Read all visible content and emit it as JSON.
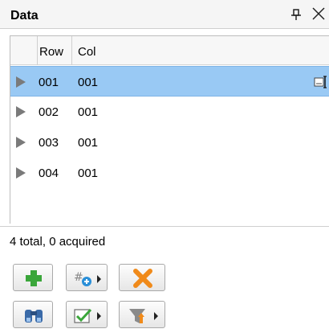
{
  "panel": {
    "title": "Data"
  },
  "grid": {
    "columns": [
      "Row",
      "Col"
    ],
    "rows": [
      {
        "row": "001",
        "col": "001",
        "selected": true
      },
      {
        "row": "002",
        "col": "001",
        "selected": false
      },
      {
        "row": "003",
        "col": "001",
        "selected": false
      },
      {
        "row": "004",
        "col": "001",
        "selected": false
      }
    ]
  },
  "status": {
    "text": "4 total, 0 acquired"
  },
  "toolbar": {
    "row1": [
      "add-icon",
      "add-numbered-icon",
      "delete-icon"
    ],
    "row2": [
      "find-icon",
      "check-icon",
      "filter-sort-icon"
    ]
  },
  "colors": {
    "selection": "#99c9f4",
    "add_green": "#3aa63a",
    "delete_orange": "#f08a1a"
  }
}
